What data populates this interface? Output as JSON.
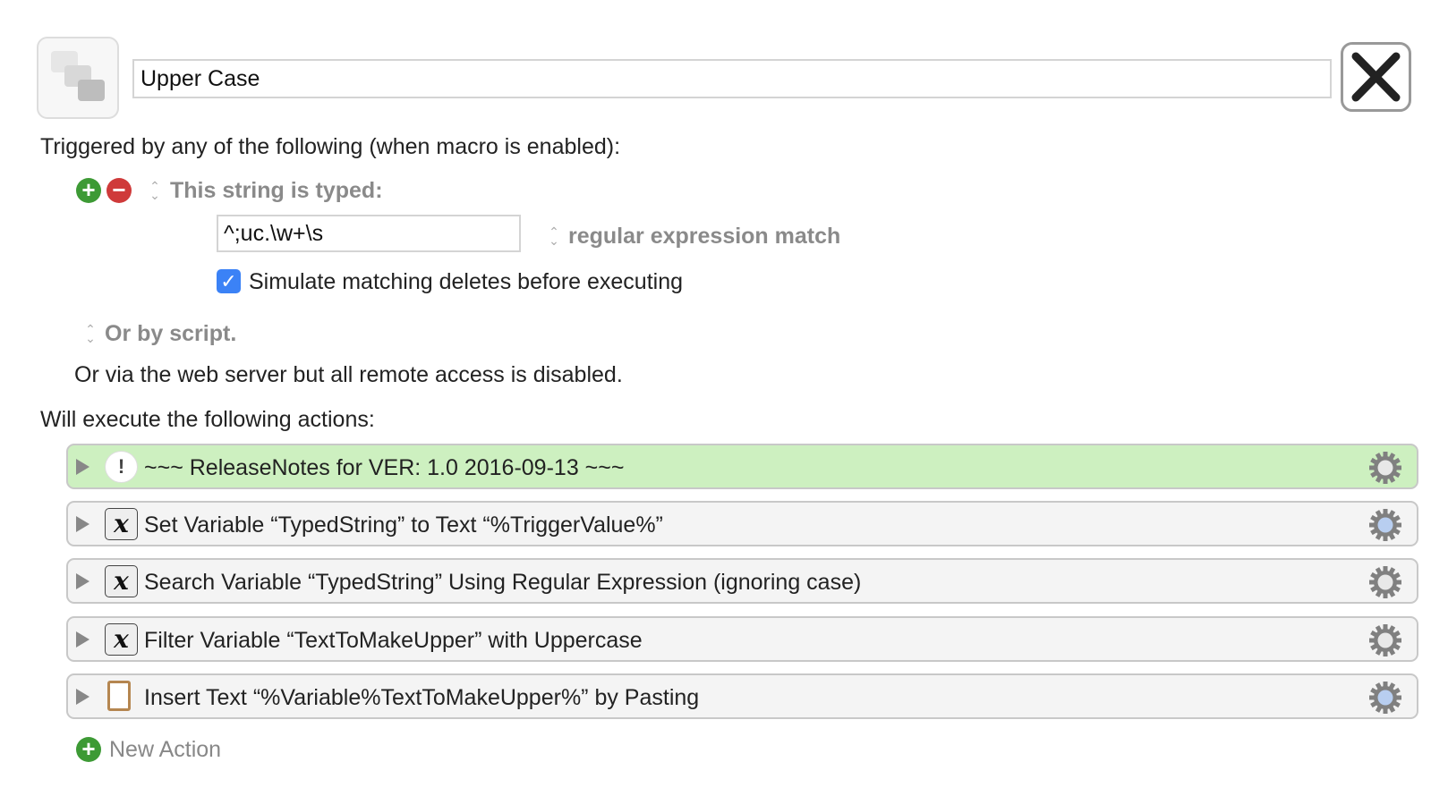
{
  "macro": {
    "name": "Upper Case",
    "icon": "macro-keys-icon",
    "close_icon": "close-x-icon"
  },
  "triggers": {
    "heading": "Triggered by any of the following (when macro is enabled):",
    "typed_string": {
      "label": "This string is typed:",
      "value": "^;uc.\\w+\\s",
      "match_mode": "regular expression match",
      "simulate_deletes_label": "Simulate matching deletes before executing",
      "simulate_deletes_checked": true
    },
    "script_label": "Or by script.",
    "web_server_note": "Or via the web server but all remote access is disabled."
  },
  "actions": {
    "heading": "Will execute the following actions:",
    "items": [
      {
        "label": "~~~ ReleaseNotes for VER: 1.0    2016-09-13 ~~~",
        "icon": "comment-icon",
        "highlight": true,
        "gear_color": "#e8e8e8"
      },
      {
        "label": "Set Variable “TypedString” to Text “%TriggerValue%”",
        "icon": "variable-icon",
        "highlight": false,
        "gear_color": "#b8cef0"
      },
      {
        "label": "Search Variable “TypedString” Using Regular Expression (ignoring case)",
        "icon": "variable-icon",
        "highlight": false,
        "gear_color": "#e8e8e8"
      },
      {
        "label": "Filter Variable “TextToMakeUpper” with Uppercase",
        "icon": "variable-icon",
        "highlight": false,
        "gear_color": "#e8e8e8"
      },
      {
        "label": "Insert Text “%Variable%TextToMakeUpper%” by Pasting",
        "icon": "clipboard-icon",
        "highlight": false,
        "gear_color": "#b8cef0"
      }
    ],
    "new_action_label": "New Action"
  },
  "colors": {
    "add": "#3d9a35",
    "remove": "#cf3a3a",
    "highlight": "#cdf0c0",
    "checkbox": "#3b82f6"
  }
}
